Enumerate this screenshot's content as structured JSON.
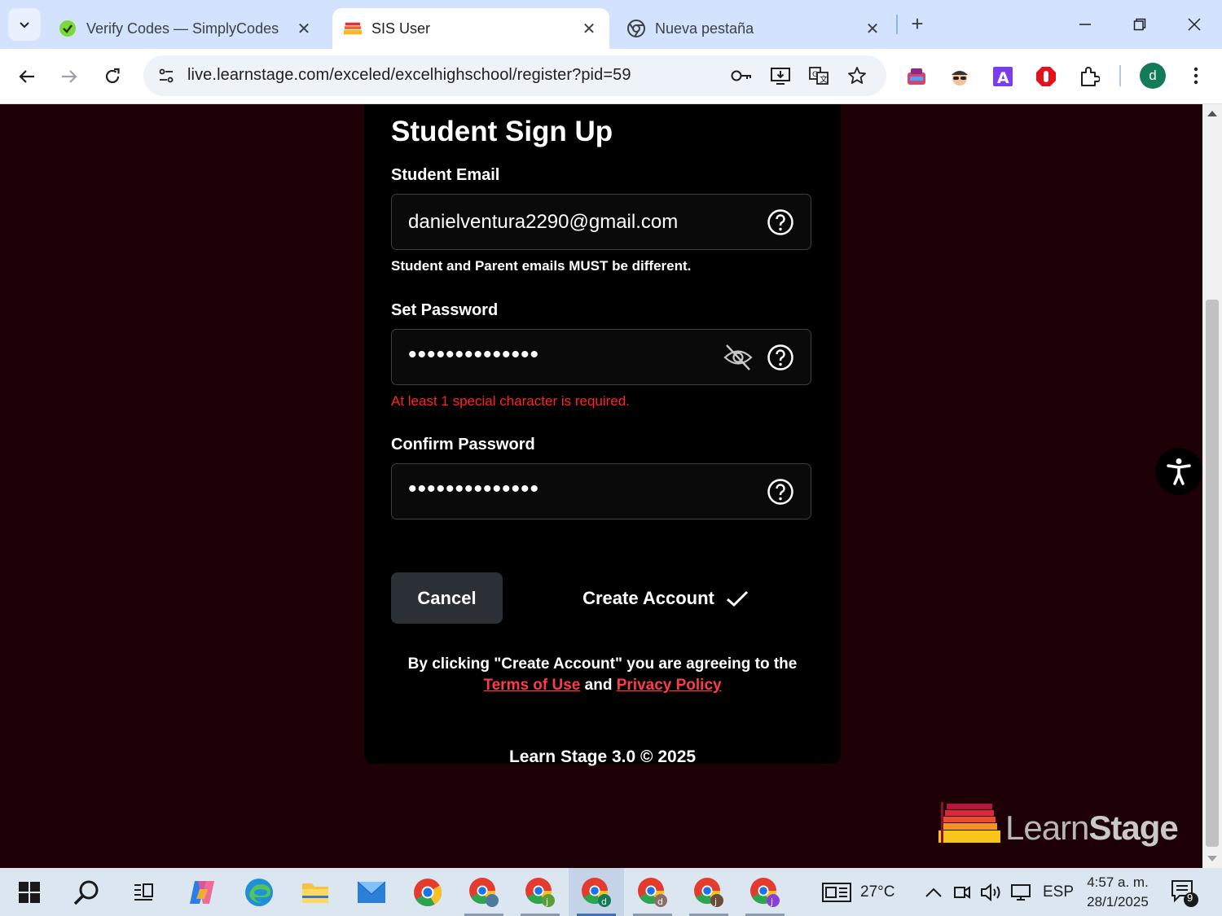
{
  "browser": {
    "tabs": [
      {
        "title": "Verify Codes — SimplyCodes",
        "icon": "simplycodes-icon"
      },
      {
        "title": "SIS User",
        "icon": "learnstage-icon",
        "active": true
      },
      {
        "title": "Nueva pestaña",
        "icon": "chrome-icon"
      }
    ],
    "url": "live.learnstage.com/exceled/excelhighschool/register?pid=59",
    "profile_initial": "d"
  },
  "form": {
    "title": "Student Sign Up",
    "email_label": "Student Email",
    "email_value": "danielventura2290@gmail.com",
    "email_hint": "Student and Parent emails MUST be different.",
    "password_label": "Set Password",
    "password_value": "••••••••••••••",
    "password_error": "At least 1 special character is required.",
    "confirm_label": "Confirm Password",
    "confirm_value": "••••••••••••••",
    "cancel_label": "Cancel",
    "create_label": "Create Account",
    "agree_text": "By clicking \"Create Account\" you are agreeing to the",
    "terms_label": "Terms of Use",
    "and_text": "and",
    "privacy_label": "Privacy Policy",
    "footer": "Learn Stage 3.0 © 2025"
  },
  "brand": {
    "part1": "Learn",
    "part2": "Stage"
  },
  "colors": {
    "page_bg": "#1d0106",
    "card_bg": "#000000",
    "error": "#ff2424",
    "link": "#ff3b4a",
    "button_bg": "#2b2f36"
  },
  "taskbar": {
    "weather": "27°C",
    "language": "ESP",
    "time": "4:57 a. m.",
    "date": "28/1/2025",
    "notifications": "9"
  }
}
